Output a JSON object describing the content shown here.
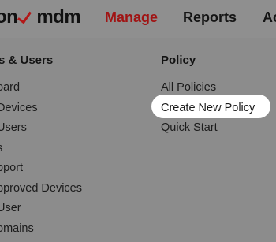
{
  "header": {
    "brand_prefix": "on",
    "brand_suffix": "mdm",
    "nav": [
      "Manage",
      "Reports",
      "Ac"
    ],
    "colors": {
      "accent": "#a01414",
      "check": "#b21818"
    }
  },
  "menu": {
    "left": {
      "heading": "s & Users",
      "items": [
        "oard",
        " Devices",
        " Users",
        "s",
        "pport",
        "pproved Devices",
        " User",
        "omains"
      ]
    },
    "right": {
      "heading": "Policy",
      "items": [
        "All Policies",
        "Create New Policy",
        "Quick Start"
      ],
      "highlighted_item": "Create New Policy"
    }
  }
}
